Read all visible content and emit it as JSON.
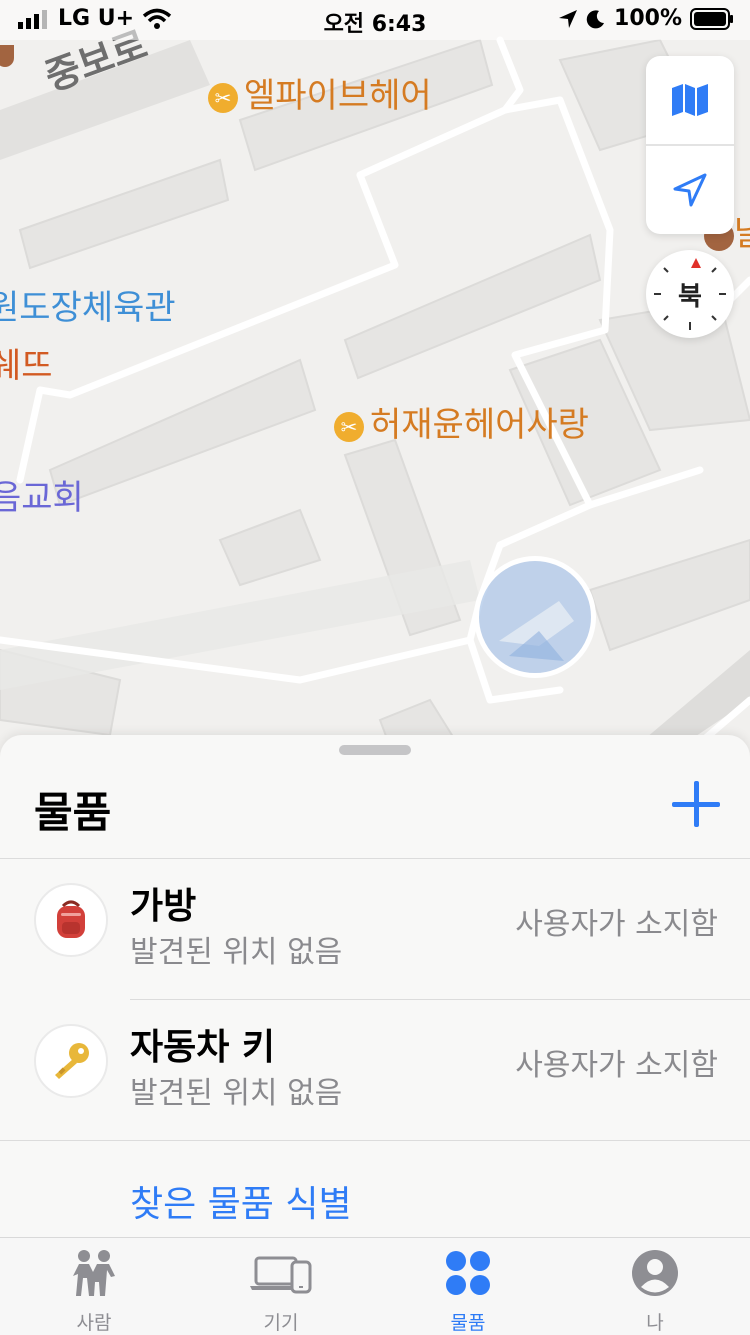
{
  "status_bar": {
    "carrier": "LG U+",
    "time": "오전 6:43",
    "battery": "100%"
  },
  "map": {
    "labels": {
      "road": "중보로",
      "salon1": "엘파이브헤어",
      "gym": "원도장체육관",
      "shop": "쉐뜨",
      "salon2": "허재윤헤어사랑",
      "church": "음교회",
      "edge": "날"
    },
    "compass_label": "북",
    "poi_icon": "scissors-icon"
  },
  "sheet": {
    "title": "물품",
    "items": [
      {
        "name": "가방",
        "subtitle": "발견된 위치 없음",
        "status": "사용자가 소지함",
        "icon": "backpack-icon"
      },
      {
        "name": "자동차 키",
        "subtitle": "발견된 위치 없음",
        "status": "사용자가 소지함",
        "icon": "key-icon"
      }
    ],
    "identify_link": "찾은 물품 식별"
  },
  "tabs": [
    {
      "label": "사람",
      "icon": "people-icon"
    },
    {
      "label": "기기",
      "icon": "devices-icon"
    },
    {
      "label": "물품",
      "icon": "items-icon",
      "active": true
    },
    {
      "label": "나",
      "icon": "me-icon"
    }
  ],
  "colors": {
    "accent": "#2f7cf6",
    "secondary_text": "#8a8a8e",
    "poi_orange": "#d57b22"
  }
}
